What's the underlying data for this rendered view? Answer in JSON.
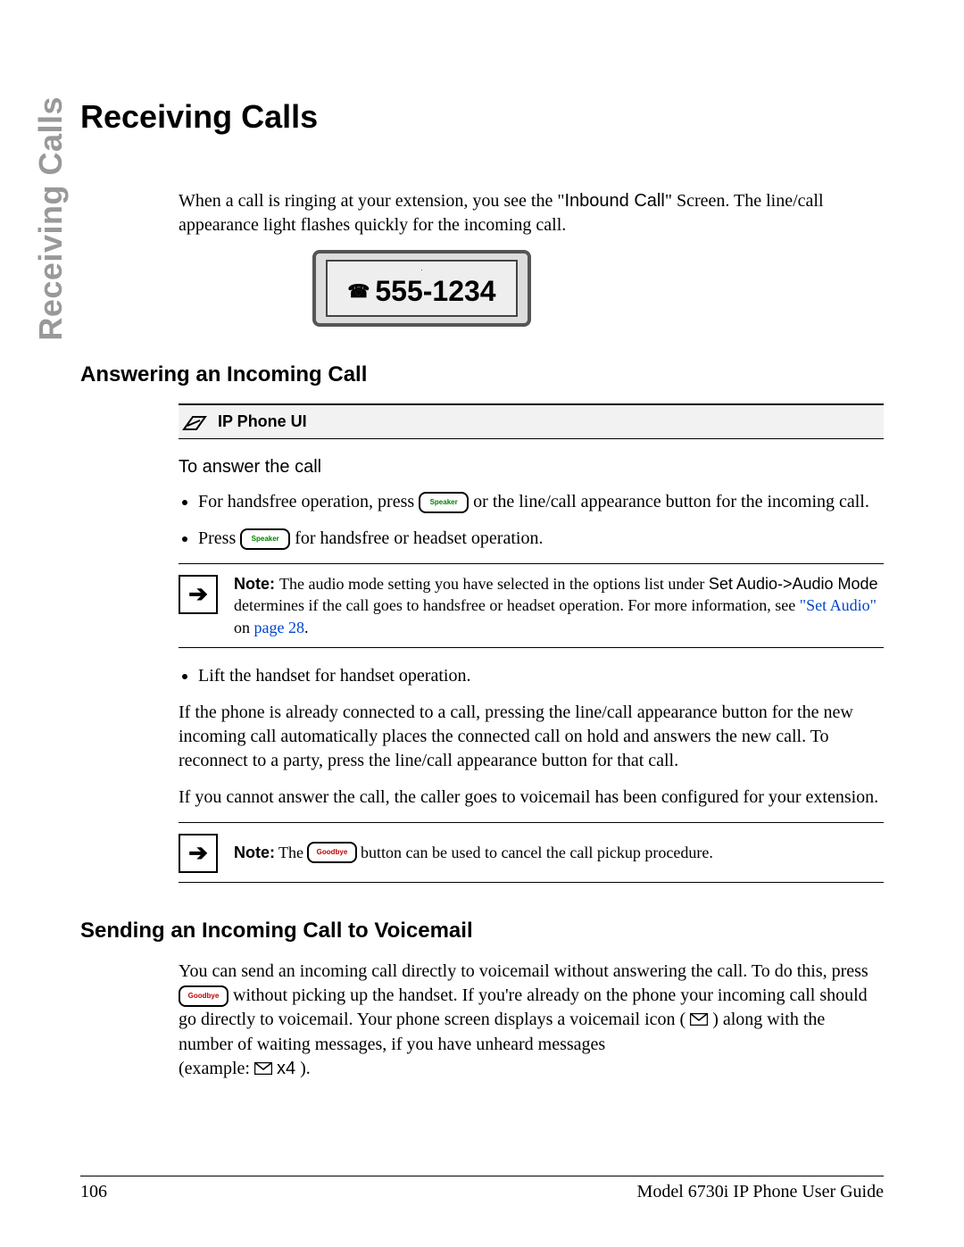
{
  "side_title": "Receiving Calls",
  "chapter_title": "Receiving Calls",
  "intro": {
    "pre": "When a call is ringing at your extension, you see the \"",
    "inbound": "Inbound Call",
    "post": "\" Screen. The line/call appearance light flashes quickly for the incoming call."
  },
  "screen_number": "555-1234",
  "section1_title": "Answering an Incoming Call",
  "ui_header": "IP Phone UI",
  "answer_lead": "To answer the call",
  "bullet1_pre": "For handsfree operation, press ",
  "bullet1_post": " or the line/call appearance button for the incoming call.",
  "bullet2_pre": "Press ",
  "bullet2_post": " for handsfree or headset operation.",
  "note1": {
    "label": "Note: ",
    "t1": "The audio mode setting you have selected in the options list under ",
    "path": "Set Audio->Audio Mode",
    "t2": " determines if the call goes to handsfree or headset operation. For more information, see ",
    "link_text": "\"Set Audio\"",
    "t3": " on ",
    "page_link": "page 28",
    "t4": "."
  },
  "bullet3": "Lift the handset for handset operation.",
  "para_connected": "If the phone is already connected to a call, pressing the line/call appearance button for the new incoming call automatically places the connected call on hold and answers the new call. To reconnect to a party, press the line/call appearance button for that call.",
  "para_voicemail": "If you cannot answer the call, the caller goes to voicemail has been configured for your extension.",
  "note2": {
    "label": "Note: ",
    "pre": "The ",
    "post": " button can be used to cancel the call pickup procedure."
  },
  "section2_title": "Sending an Incoming Call to Voicemail",
  "vm_para": {
    "t1": "You can send an incoming call directly to voicemail without answering the call. To do this, press ",
    "t2": " without picking up the handset. If you're already on the phone your incoming call should go directly to voicemail. Your phone screen displays a voicemail icon ( ",
    "t3": " ) along with the number of waiting messages, if you have unheard messages",
    "t4": "(example: ",
    "count": " x4",
    "t5": " )."
  },
  "key_speaker": "Speaker",
  "key_goodbye": "Goodbye",
  "footer_page": "106",
  "footer_guide": "Model 6730i IP Phone User Guide"
}
